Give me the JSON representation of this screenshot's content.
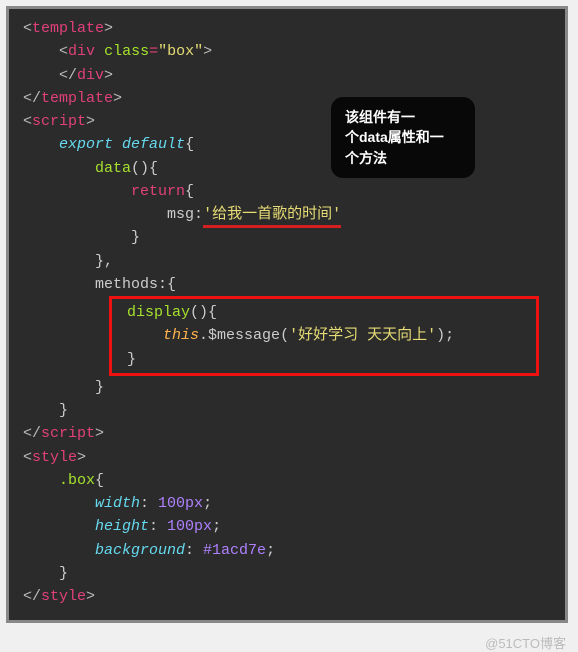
{
  "code": {
    "tags": {
      "template": "template",
      "div": "div",
      "script": "script",
      "style": "style"
    },
    "attrs": {
      "class": "class",
      "box": "\"box\""
    },
    "keywords": {
      "export": "export",
      "default": "default",
      "return": "return",
      "this": "this"
    },
    "identifiers": {
      "data": "data",
      "msg": "msg",
      "methods": "methods",
      "display": "display",
      "message": "$message",
      "box_sel": ".box"
    },
    "css": {
      "width": "width",
      "height": "height",
      "background": "background",
      "px100": "100px",
      "color": "#1acd7e"
    },
    "strings": {
      "msg_val": "'给我一首歌的时间'",
      "message_arg": "'好好学习 天天向上'"
    }
  },
  "tooltip": {
    "line1": "该组件有一",
    "line2": "个data属性和一",
    "line3": "个方法"
  },
  "watermark": "@51CTO博客"
}
